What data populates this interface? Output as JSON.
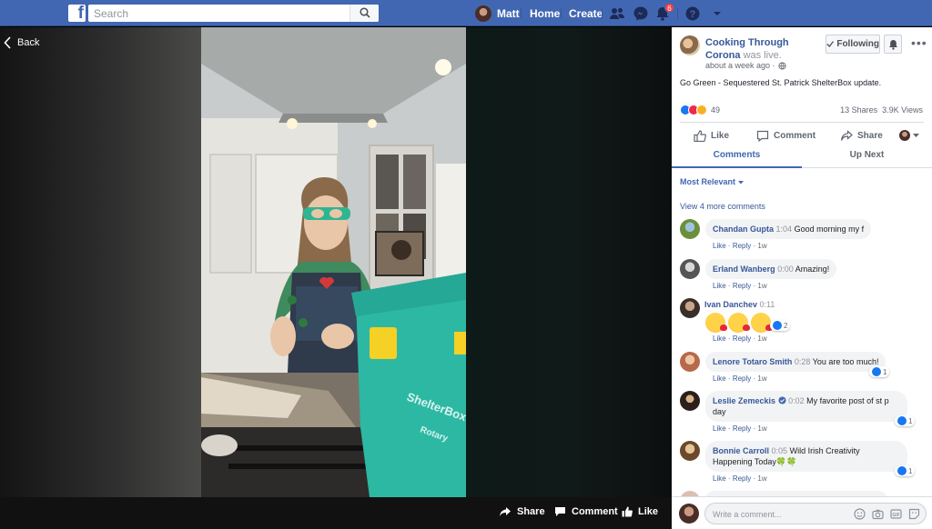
{
  "topbar": {
    "search_placeholder": "Search",
    "user_name": "Matt",
    "home_label": "Home",
    "create_label": "Create",
    "notifications_count": "6",
    "colors": {
      "bar": "#4267b2"
    }
  },
  "video": {
    "back_label": "Back",
    "controls": {
      "share_label": "Share",
      "comment_label": "Comment",
      "like_label": "Like"
    },
    "box_text_1": "ShelterBox",
    "box_text_2": "Rotary"
  },
  "post": {
    "page_name": "Cooking Through Corona",
    "was_live": "was live.",
    "time": "about a week ago ·",
    "following_label": "Following",
    "text": "Go Green - Sequestered St. Patrick ShelterBox update.",
    "reaction_count": "49",
    "shares": "13 Shares",
    "views": "3.9K Views",
    "actions": {
      "like": "Like",
      "comment": "Comment",
      "share": "Share"
    },
    "tabs": {
      "comments": "Comments",
      "up_next": "Up Next"
    },
    "sort_label": "Most Relevant",
    "view_more": "View 4 more comments",
    "comment_placeholder": "Write a comment..."
  },
  "comments": [
    {
      "name": "Chandan Gupta",
      "time": "1:04",
      "text": "Good morning my f",
      "like": "Like",
      "reply": "Reply",
      "age": "1w"
    },
    {
      "name": "Erland Wanberg",
      "time": "0:00",
      "text": "Amazing!",
      "like": "Like",
      "reply": "Reply",
      "age": "1w"
    },
    {
      "name": "Ivan Danchev",
      "time": "0:11",
      "text": "",
      "reactions": "2",
      "like": "Like",
      "reply": "Reply",
      "age": "1w"
    },
    {
      "name": "Lenore Totaro Smith",
      "time": "0:28",
      "text": "You are too much!",
      "reactions": "1",
      "like": "Like",
      "reply": "Reply",
      "age": "1w"
    },
    {
      "name": "Leslie Zemeckis",
      "time": "0:02",
      "text": "My favorite post of st p",
      "text2": "day",
      "reactions": "1",
      "like": "Like",
      "reply": "Reply",
      "age": "1w"
    },
    {
      "name": "Bonnie Carroll",
      "time": "0:05",
      "text": "Wild Irish Creativity",
      "text2": "Happening Today",
      "clover": "🍀🍀",
      "reactions": "1",
      "like": "Like",
      "reply": "Reply",
      "age": "1w"
    }
  ]
}
